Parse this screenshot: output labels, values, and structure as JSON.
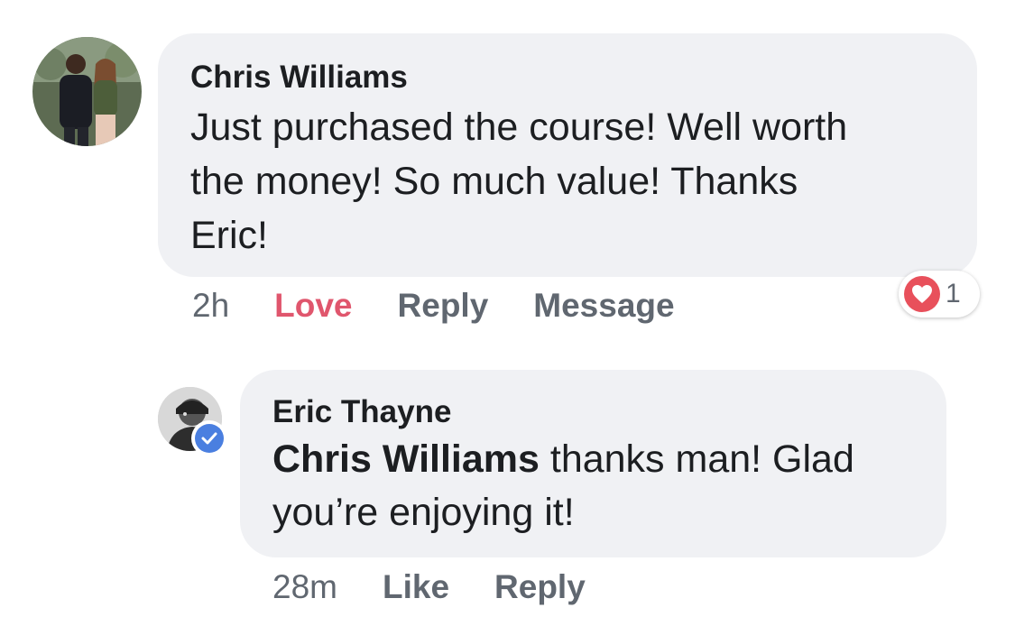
{
  "comment": {
    "author": "Chris Williams",
    "text_lines": [
      "Just purchased the course! Well worth",
      "the money! So much value! Thanks",
      "Eric!"
    ],
    "time": "2h",
    "actions": {
      "love": "Love",
      "reply": "Reply",
      "message": "Message"
    },
    "reaction": {
      "icon": "heart-icon",
      "count": "1",
      "color": "#e8505b"
    }
  },
  "reply": {
    "author": "Eric Thayne",
    "mention": "Chris Williams",
    "text_line1_rest": " thanks man! Glad",
    "text_line2": "you’re enjoying it!",
    "time": "28m",
    "actions": {
      "like": "Like",
      "reply": "Reply"
    },
    "verified_icon": "verified-check-icon"
  },
  "colors": {
    "bubble": "#f0f1f4",
    "love": "#e0566d",
    "meta": "#606770",
    "verified": "#4a7fe0"
  }
}
